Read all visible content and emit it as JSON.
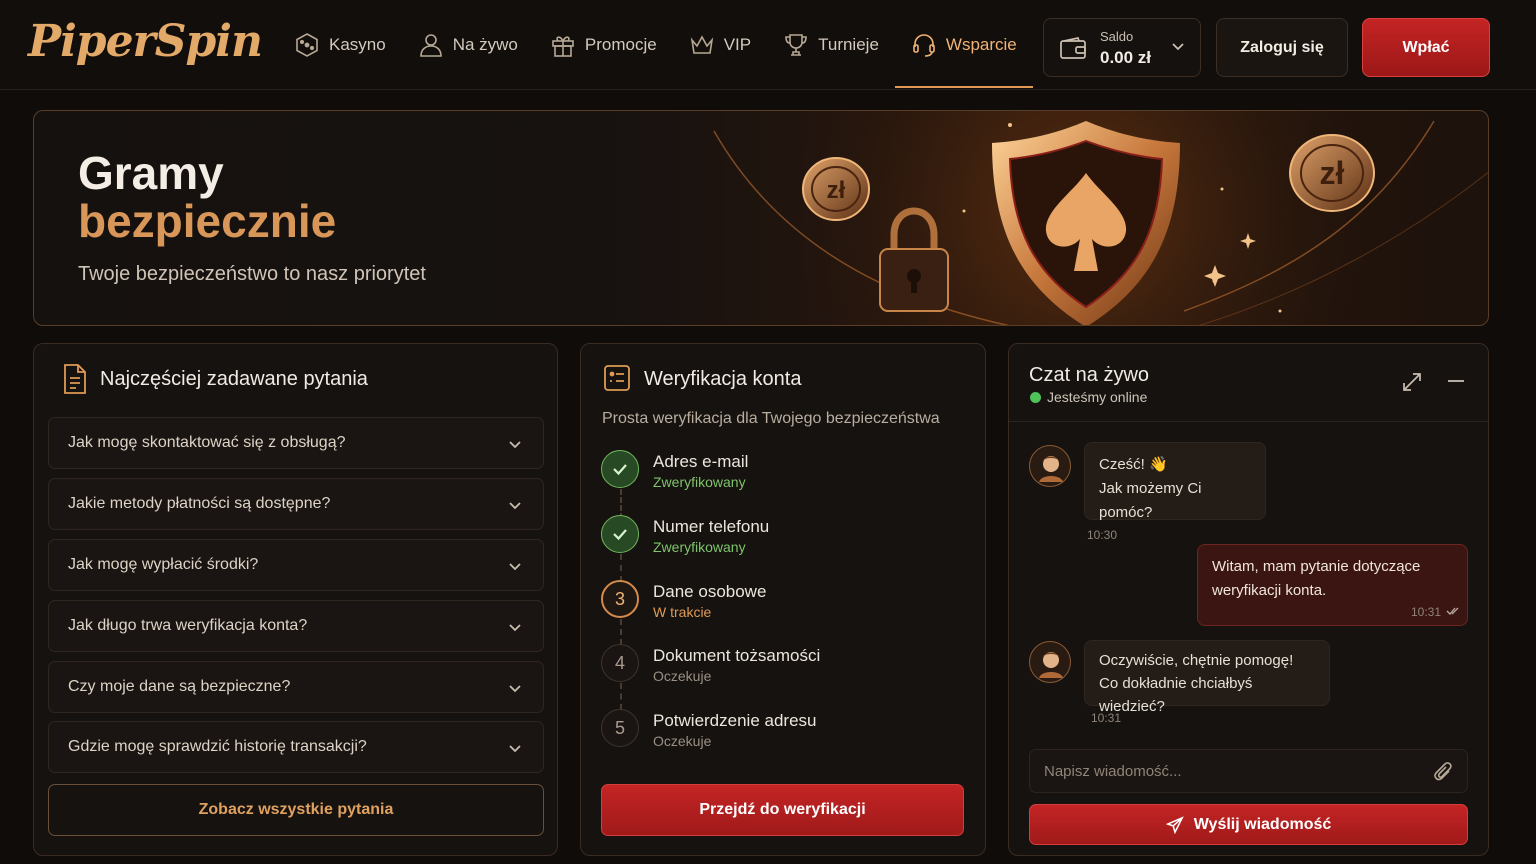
{
  "brand": {
    "logo_text": "PiperSpin"
  },
  "nav": {
    "items": [
      {
        "label": "Kasyno",
        "icon": "dice-icon"
      },
      {
        "label": "Na żywo",
        "icon": "person-icon"
      },
      {
        "label": "Promocje",
        "icon": "gift-icon"
      },
      {
        "label": "VIP",
        "icon": "crown-icon"
      },
      {
        "label": "Turnieje",
        "icon": "trophy-icon"
      },
      {
        "label": "Wsparcie",
        "icon": "headset-icon",
        "active": true
      }
    ]
  },
  "account": {
    "balance_label": "Saldo",
    "balance_value": "0.00 zł",
    "login_label": "Zaloguj się",
    "deposit_label": "Wpłać"
  },
  "hero": {
    "title_line1": "Gramy",
    "title_line2": "bezpiecznie",
    "subtitle": "Twoje bezpieczeństwo to nasz priorytet"
  },
  "faq": {
    "title": "Najczęściej zadawane pytania",
    "items": [
      "Jak mogę skontaktować się z obsługą?",
      "Jakie metody płatności są dostępne?",
      "Jak mogę wypłacić środki?",
      "Jak długo trwa weryfikacja konta?",
      "Czy moje dane są bezpieczne?",
      "Gdzie mogę sprawdzić historię transakcji?"
    ],
    "see_all_label": "Zobacz wszystkie pytania"
  },
  "verification": {
    "title": "Weryfikacja konta",
    "subtitle": "Prosta weryfikacja dla Twojego bezpieczeństwa",
    "steps": [
      {
        "marker": "",
        "name": "Adres e-mail",
        "status": "Zweryfikowany"
      },
      {
        "marker": "",
        "name": "Numer telefonu",
        "status": "Zweryfikowany"
      },
      {
        "marker": "3",
        "name": "Dane osobowe",
        "status": "W trakcie"
      },
      {
        "marker": "4",
        "name": "Dokument tożsamości",
        "status": "Oczekuje"
      },
      {
        "marker": "5",
        "name": "Potwierdzenie adresu",
        "status": "Oczekuje"
      }
    ],
    "button_label": "Przejdź do weryfikacji"
  },
  "chat": {
    "title": "Czat na żywo",
    "status": "Jesteśmy online",
    "messages": [
      {
        "from": "agent",
        "line1": "Cześć! 👋",
        "line2": "Jak możemy Ci pomóc?",
        "time": "10:30"
      },
      {
        "from": "user",
        "line1": "Witam, mam pytanie dotyczące",
        "line2": "weryfikacji konta.",
        "time": "10:31"
      },
      {
        "from": "agent",
        "line1": "Oczywiście, chętnie pomogę!",
        "line2": "Co dokładnie chciałbyś wiedzieć?",
        "time": "10:31"
      }
    ],
    "input_placeholder": "Napisz wiadomość...",
    "send_label": "Wyślij wiadomość"
  },
  "colors": {
    "accent": "#e09a55",
    "primary_button": "#b81f1f",
    "verified": "#7fc46a",
    "in_progress": "#e09a55",
    "online": "#4fc25a"
  }
}
